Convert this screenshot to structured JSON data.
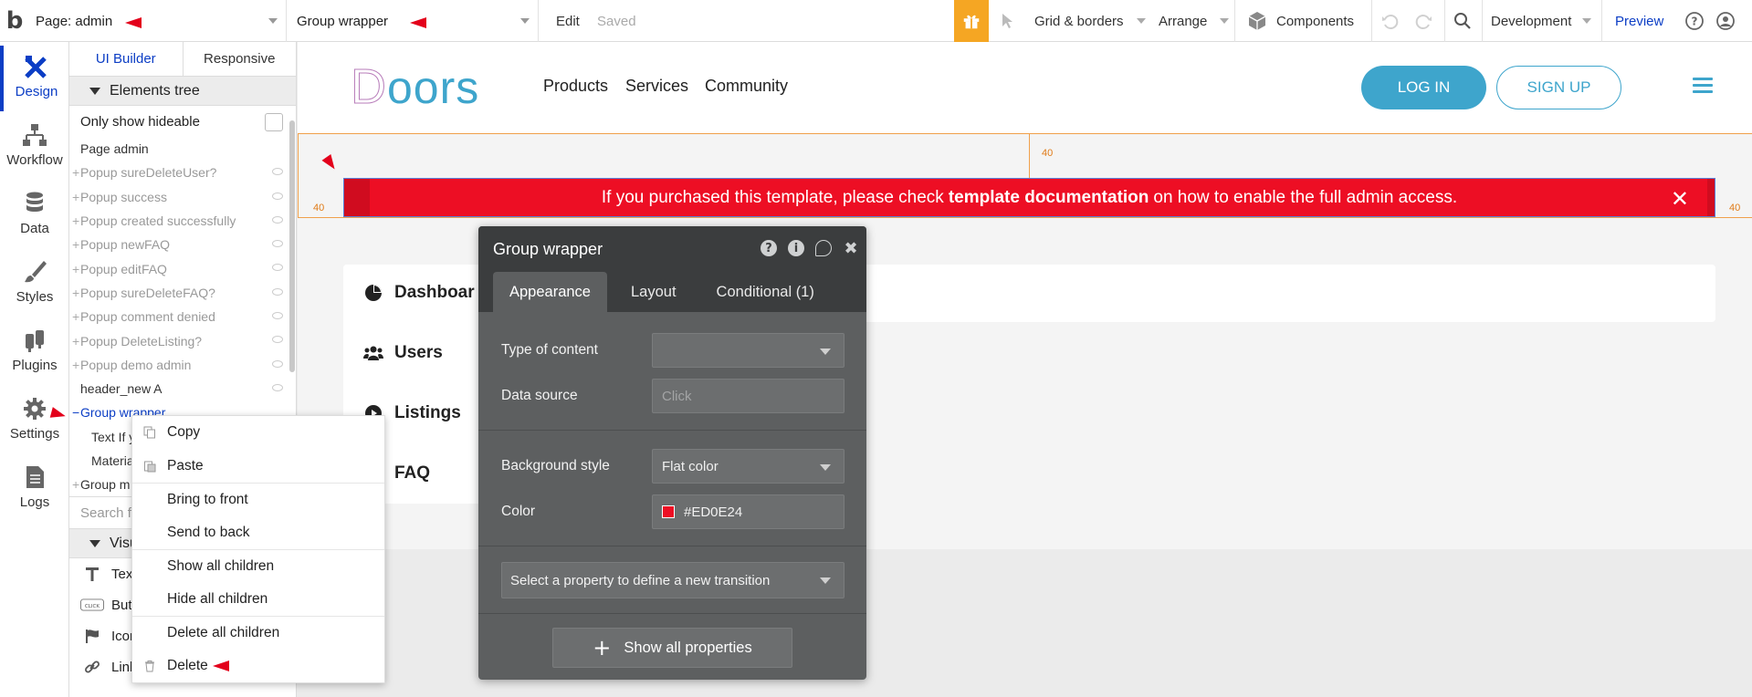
{
  "topbar": {
    "logo": "b",
    "page_dropdown": "Page: admin",
    "element_dropdown": "Group wrapper",
    "edit_label": "Edit",
    "saved_label": "Saved",
    "grid_label": "Grid & borders",
    "arrange_label": "Arrange",
    "components_label": "Components",
    "development_label": "Development",
    "preview_label": "Preview"
  },
  "rail": {
    "items": [
      {
        "label": "Design"
      },
      {
        "label": "Workflow"
      },
      {
        "label": "Data"
      },
      {
        "label": "Styles"
      },
      {
        "label": "Plugins"
      },
      {
        "label": "Settings"
      },
      {
        "label": "Logs"
      }
    ]
  },
  "panel": {
    "tabs": [
      "UI Builder",
      "Responsive"
    ],
    "elements_tree_label": "Elements tree",
    "only_hideable_label": "Only show hideable",
    "tree": [
      {
        "label": "Page admin"
      },
      {
        "label": "Popup sureDeleteUser?"
      },
      {
        "label": "Popup success"
      },
      {
        "label": "Popup created successfully"
      },
      {
        "label": "Popup newFAQ"
      },
      {
        "label": "Popup editFAQ"
      },
      {
        "label": "Popup sureDeleteFAQ?"
      },
      {
        "label": "Popup comment denied"
      },
      {
        "label": "Popup DeleteListing?"
      },
      {
        "label": "Popup demo admin"
      },
      {
        "label": "header_new A"
      },
      {
        "label": "Group wrapper"
      },
      {
        "label": "Text If y"
      },
      {
        "label": "Materia"
      },
      {
        "label": "Group m"
      }
    ],
    "search_placeholder": "Search f",
    "visual_section_label": "Visu",
    "visual_items": [
      {
        "label": "Text",
        "icon": "text-T-icon"
      },
      {
        "label": "Butt",
        "icon": "click-button-icon"
      },
      {
        "label": "Icon",
        "icon": "flag-icon"
      },
      {
        "label": "Link",
        "icon": "link-icon"
      }
    ]
  },
  "context_menu": {
    "items": [
      "Copy",
      "Paste",
      "Bring to front",
      "Send to back",
      "Show all children",
      "Hide all children",
      "Delete all children",
      "Delete"
    ]
  },
  "canvas": {
    "brand": {
      "first": "D",
      "rest": "oors",
      "first_color": "#c38cc5",
      "rest_color": "#3ea5cc"
    },
    "nav": [
      "Products",
      "Services",
      "Community"
    ],
    "login_label": "LOG IN",
    "signup_label": "SIGN UP",
    "guides": {
      "top": "40",
      "left": "40",
      "right": "40"
    },
    "banner": {
      "pre": "If you purchased this template, please check",
      "bold": "template documentation",
      "post": "on how to enable the full admin access.",
      "close": "✕"
    },
    "side_menu": [
      {
        "label": "Dashboar",
        "icon": "pie-chart-icon"
      },
      {
        "label": "Users",
        "icon": "users-icon"
      },
      {
        "label": "Listings",
        "icon": "play-circle-icon"
      },
      {
        "label": "FAQ",
        "icon": "question-circle-icon"
      }
    ]
  },
  "editor": {
    "title": "Group wrapper",
    "tabs": [
      "Appearance",
      "Layout",
      "Conditional (1)"
    ],
    "type_of_content_label": "Type of content",
    "type_of_content_value": "",
    "data_source_label": "Data source",
    "data_source_placeholder": "Click",
    "background_style_label": "Background style",
    "background_style_value": "Flat color",
    "color_label": "Color",
    "color_value": "#ED0E24",
    "transition_label": "Select a property to define a new transition",
    "show_all_label": "Show all properties"
  },
  "colors": {
    "accent_blue": "#0c3ec5",
    "banner_red": "#ED0E24",
    "brand_teal": "#3ea5cc",
    "gift_orange": "#f5a623"
  }
}
